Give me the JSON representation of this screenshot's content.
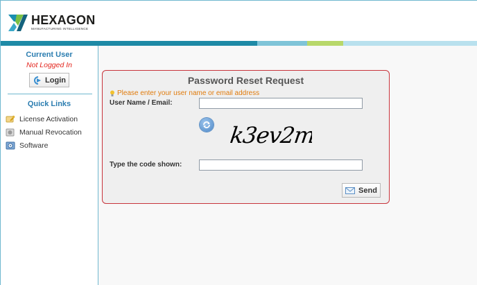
{
  "brand": {
    "name": "HEXAGON",
    "tagline": "MANUFACTURING INTELLIGENCE"
  },
  "sidebar": {
    "current_user_title": "Current User",
    "status": "Not Logged In",
    "login_label": "Login",
    "quick_links_title": "Quick Links",
    "items": [
      {
        "label": "License Activation",
        "icon": "key-icon"
      },
      {
        "label": "Manual Revocation",
        "icon": "revoke-icon"
      },
      {
        "label": "Software",
        "icon": "software-icon"
      }
    ]
  },
  "dialog": {
    "title": "Password Reset Request",
    "hint": "Please enter your user name or email address",
    "user_label": "User Name / Email:",
    "user_value": "",
    "captcha_text": "k3ev2m",
    "code_label": "Type the code shown:",
    "code_value": "",
    "send_label": "Send"
  },
  "colors": {
    "accent": "#2b7db0",
    "dialog_border": "#c8343b",
    "hint": "#e07b0c",
    "error": "#e3231b"
  }
}
